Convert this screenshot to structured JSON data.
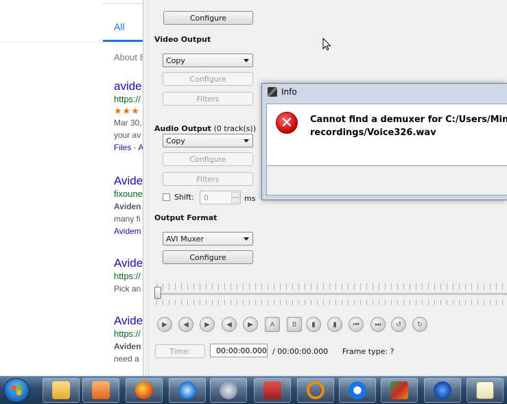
{
  "browser": {
    "tab_all": "All",
    "about": "About 8",
    "results": [
      {
        "title": "avide",
        "url": "https://",
        "stars": "★★★",
        "snippet1": "Mar 30,",
        "snippet2": "your av",
        "links": "Files · A"
      },
      {
        "title": "Avide",
        "url": "fixoune",
        "bold": "Aviden",
        "snippet1": "many fi",
        "link": "Avidem"
      },
      {
        "title": "Avide",
        "url": "https://",
        "snippet1": "Pick an"
      },
      {
        "title": "Avide",
        "url": "https://",
        "bold": "Aviden",
        "snippet1": "need a"
      }
    ]
  },
  "avidemux": {
    "top_configure": "Configure",
    "video_output": {
      "label": "Video Output",
      "codec": "Copy",
      "configure": "Configure",
      "filters": "Filters"
    },
    "audio_output": {
      "label": "Audio Output",
      "tracks": "(0 track(s))",
      "codec": "Copy",
      "configure": "Configure",
      "filters": "Filters",
      "shift_label": "Shift:",
      "shift_value": "0",
      "shift_unit": "ms"
    },
    "output_format": {
      "label": "Output Format",
      "muxer": "AVI Muxer",
      "configure": "Configure"
    },
    "time_button": "Time:",
    "time_value": "00:00:00.000",
    "time_total": "/ 00:00:00.000",
    "frame_type": "Frame type:  ?"
  },
  "dialog": {
    "title": "Info",
    "message_line1": "Cannot find a demuxer for C:/Users/Ministe",
    "message_line2": "recordings/Voice326.wav",
    "icon": "error-icon"
  },
  "taskbar": {
    "items": [
      "windows-explorer",
      "media-player",
      "firefox",
      "browser-swirl",
      "network-app",
      "toolbox-app",
      "search-app",
      "teamviewer",
      "avidemux",
      "malwarebytes",
      "notepad-plus-plus"
    ]
  }
}
